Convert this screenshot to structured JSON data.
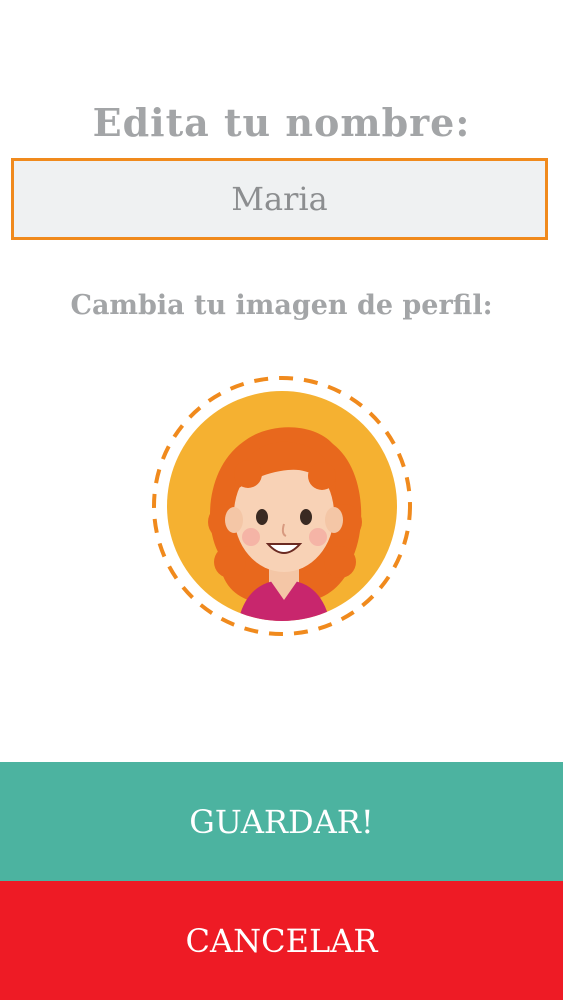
{
  "profile": {
    "edit_name_label": "Edita tu nombre:",
    "name_value": "Maria",
    "change_image_label": "Cambia tu imagen de perfil:",
    "avatar_icon": "redhead-girl-avatar"
  },
  "actions": {
    "save_label": "GUARDAR!",
    "cancel_label": "CANCELAR"
  },
  "colors": {
    "accent_orange": "#f08a1d",
    "save_green": "#4cb3a0",
    "cancel_red": "#ee1b25",
    "label_gray": "#a3a5a7"
  }
}
